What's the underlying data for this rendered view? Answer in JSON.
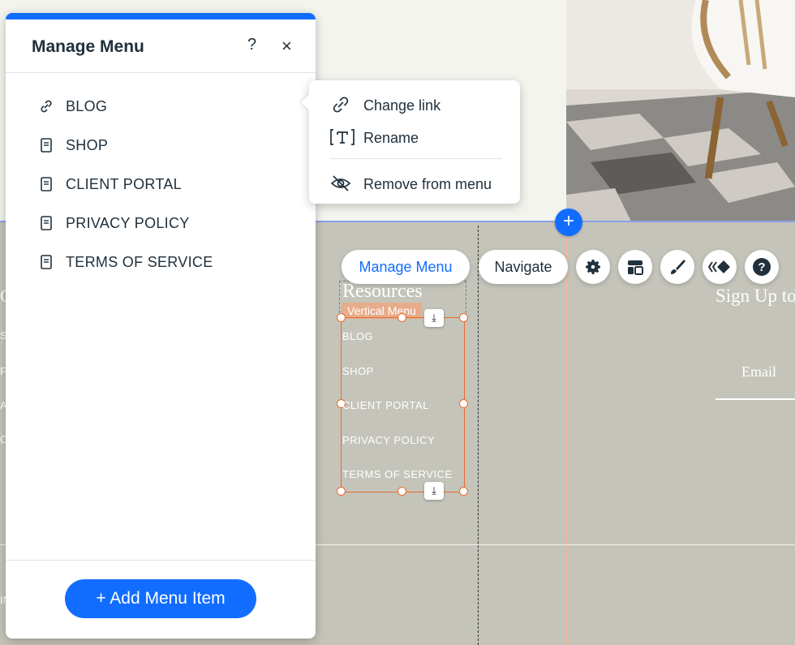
{
  "panel": {
    "title": "Manage Menu",
    "help_glyph": "?",
    "close_glyph": "×",
    "items": [
      {
        "label": "BLOG",
        "icon": "link-icon"
      },
      {
        "label": "SHOP",
        "icon": "page-icon"
      },
      {
        "label": "CLIENT PORTAL",
        "icon": "page-icon"
      },
      {
        "label": "PRIVACY POLICY",
        "icon": "page-icon"
      },
      {
        "label": "TERMS OF SERVICE",
        "icon": "page-icon"
      }
    ],
    "add_button_label": "+ Add Menu Item"
  },
  "popover": {
    "items": [
      {
        "label": "Change link",
        "icon": "link-icon"
      },
      {
        "label": "Rename",
        "icon": "text-icon"
      },
      {
        "label": "Remove from menu",
        "icon": "eye-hidden-icon"
      }
    ]
  },
  "toolbar": {
    "manage_menu_label": "Manage Menu",
    "navigate_label": "Navigate",
    "tools": [
      "gear-icon",
      "layout-icon",
      "brush-icon",
      "animation-icon",
      "help-icon"
    ]
  },
  "canvas": {
    "section_title": "Resources",
    "element_tag": "Vertical Menu",
    "menu_items": [
      "BLOG",
      "SHOP",
      "CLIENT PORTAL",
      "PRIVACY POLICY",
      "TERMS OF SERVICE"
    ],
    "signup_title": "Sign Up to",
    "email_label": "Email",
    "add_section_glyph": "+",
    "left_fragments": [
      "C",
      "S",
      "F",
      "A",
      "C",
      "IN"
    ]
  },
  "colors": {
    "accent": "#116dff",
    "selection": "#e86d2b",
    "footer_bg": "#c5c4ba",
    "tag_bg": "#e7ac8b"
  }
}
